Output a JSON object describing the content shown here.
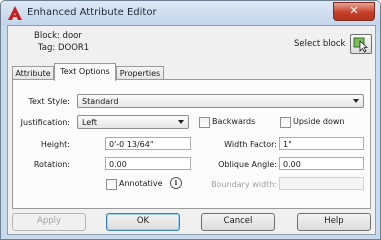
{
  "window": {
    "title": "Enhanced Attribute Editor",
    "close_glyph": "✕"
  },
  "info": {
    "block_label": "Block: door",
    "tag_label": "Tag: DOOR1",
    "select_block_label": "Select block"
  },
  "tabs": [
    {
      "label": "Attribute",
      "active": false
    },
    {
      "label": "Text Options",
      "active": true
    },
    {
      "label": "Properties",
      "active": false
    }
  ],
  "text_options": {
    "text_style_label": "Text Style:",
    "text_style_value": "Standard",
    "justification_label": "Justification:",
    "justification_value": "Left",
    "backwards_label": "Backwards",
    "upside_down_label": "Upside down",
    "height_label": "Height:",
    "height_value": "0'-0 13/64\"",
    "width_factor_label": "Width Factor:",
    "width_factor_value": "1\"",
    "rotation_label": "Rotation:",
    "rotation_value": "0.00",
    "oblique_angle_label": "Oblique Angle:",
    "oblique_angle_value": "0.00",
    "annotative_label": "Annotative",
    "info_glyph": "i",
    "boundary_width_label": "Boundary width:",
    "boundary_width_value": ""
  },
  "buttons": {
    "apply": "Apply",
    "ok": "OK",
    "cancel": "Cancel",
    "help": "Help"
  },
  "icons": {
    "app": "autocad-a-icon",
    "select_block": "select-block-cursor-icon"
  }
}
